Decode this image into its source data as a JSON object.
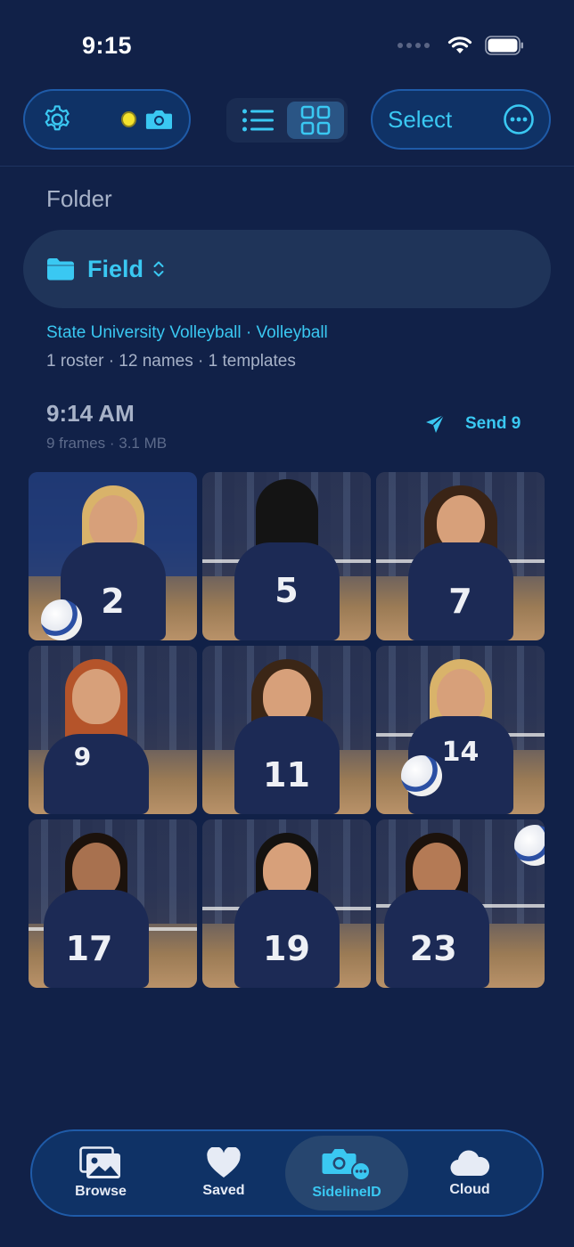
{
  "status_bar": {
    "time": "9:15"
  },
  "toolbar": {
    "select_label": "Select",
    "view_modes": [
      "list",
      "grid"
    ],
    "active_view": "grid"
  },
  "folder": {
    "section_label": "Folder",
    "name": "Field"
  },
  "team": {
    "line": "State University Volleyball · Volleyball",
    "meta": "1 roster · 12 names · 1 templates"
  },
  "session": {
    "time": "9:14 AM",
    "meta": "9 frames · 3.1 MB",
    "send_label": "Send 9"
  },
  "photos": [
    {
      "number": "2"
    },
    {
      "number": "5"
    },
    {
      "number": "7"
    },
    {
      "number": "9"
    },
    {
      "number": "11"
    },
    {
      "number": "14"
    },
    {
      "number": "17"
    },
    {
      "number": "19"
    },
    {
      "number": "23"
    }
  ],
  "tabbar": {
    "items": [
      {
        "label": "Browse",
        "icon": "photos-icon"
      },
      {
        "label": "Saved",
        "icon": "heart-icon"
      },
      {
        "label": "SidelineID",
        "icon": "camera-id-icon"
      },
      {
        "label": "Cloud",
        "icon": "cloud-icon"
      }
    ],
    "active": "SidelineID"
  },
  "colors": {
    "background": "#112148",
    "accent": "#3ac8f2",
    "pill_bg": "#0f3266",
    "pill_border": "#1f5ba8",
    "recording_dot": "#f4e32d"
  }
}
